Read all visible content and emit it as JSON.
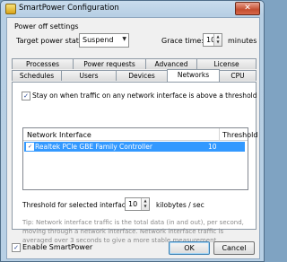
{
  "window": {
    "title": "SmartPower Configuration",
    "close_glyph": "✕"
  },
  "power_off": {
    "section_label": "Power off settings",
    "target_state_label": "Target power state:",
    "target_state_value": "Suspend",
    "grace_label": "Grace time:",
    "grace_value": "10",
    "grace_unit": "minutes"
  },
  "tabs": {
    "row1": [
      "Processes",
      "Power requests",
      "Advanced",
      "License"
    ],
    "row2": [
      "Schedules",
      "Users",
      "Devices",
      "Networks",
      "CPU"
    ],
    "active": "Networks"
  },
  "networks": {
    "stay_on_label": "Stay on when traffic on any network interface is above a threshold",
    "stay_on_checked": true,
    "columns": [
      "Network Interface",
      "Threshold"
    ],
    "rows": [
      {
        "name": "Realtek PCIe GBE Family Controller",
        "threshold": "10",
        "checked": true
      }
    ],
    "threshold_label": "Threshold for selected interface:",
    "threshold_value": "10",
    "threshold_unit": "kilobytes / sec",
    "tip": "Tip: Network interface traffic is the total data (in and out), per second, moving through a network interface. Network interface traffic is averaged over 3 seconds to give a more stable measurement."
  },
  "footer": {
    "enable_label": "Enable SmartPower",
    "enable_checked": true,
    "ok_label": "OK",
    "cancel_label": "Cancel"
  },
  "colors": {
    "selection": "#3399ff",
    "tip_text": "#8a8a8a"
  }
}
